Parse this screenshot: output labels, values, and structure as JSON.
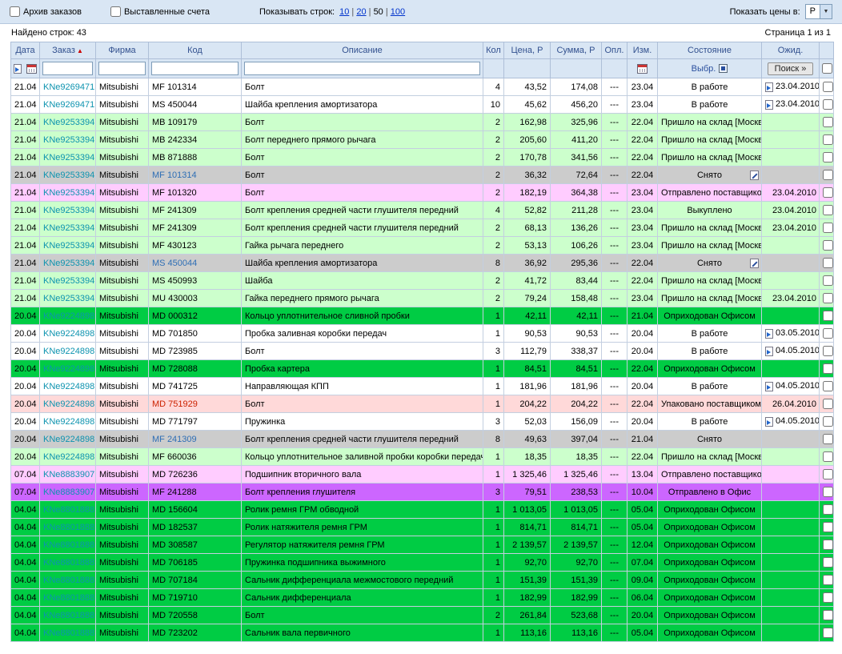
{
  "toolbar": {
    "archive_checkbox_label": "Архив заказов",
    "invoices_checkbox_label": "Выставленные счета",
    "rows_per_page_label": "Показывать строк:",
    "rows_per_page_options": [
      {
        "label": "10",
        "link": true
      },
      {
        "label": "20",
        "link": true
      },
      {
        "label": "50",
        "link": false
      },
      {
        "label": "100",
        "link": true
      }
    ],
    "currency_label": "Показать цены в:",
    "currency_value": "Р"
  },
  "statusbar": {
    "found_text": "Найдено строк: 43",
    "page_text": "Страница 1 из 1"
  },
  "colors": {
    "header_bg": "#d9e6f4",
    "row_white": "#ffffff",
    "row_lightgreen": "#ccffcc",
    "row_green": "#00cc44",
    "row_gray": "#cccccc",
    "row_magenta": "#ffccff",
    "row_salmon": "#ffd9d9",
    "row_purple": "#cc66ff",
    "order_link": "#0d93af",
    "sort_arrow": "#cc0000"
  },
  "table": {
    "headers": {
      "date": "Дата",
      "order": "Заказ",
      "firm": "Фирма",
      "code": "Код",
      "desc": "Описание",
      "qty": "Кол",
      "price": "Цена, Р",
      "sum": "Сумма, Р",
      "paid": "Опл.",
      "mod": "Изм.",
      "state": "Состояние",
      "wait": "Ожид."
    },
    "filter_row": {
      "select_label": "Выбр.",
      "search_button_label": "Поиск »"
    },
    "rows": [
      {
        "date": "21.04",
        "order": "KNe9269471",
        "firm": "Mitsubishi",
        "code": "MF 101314",
        "code_style": "normal",
        "desc": "Болт",
        "qty": "4",
        "price": "43,52",
        "sum": "174,08",
        "paid": "---",
        "mod": "23.04",
        "state": "В работе",
        "edit_icon": false,
        "wait": "23.04.2010",
        "wait_icon": true,
        "bg": "white"
      },
      {
        "date": "21.04",
        "order": "KNe9269471",
        "firm": "Mitsubishi",
        "code": "MS 450044",
        "code_style": "normal",
        "desc": "Шайба крепления амортизатора",
        "qty": "10",
        "price": "45,62",
        "sum": "456,20",
        "paid": "---",
        "mod": "23.04",
        "state": "В работе",
        "edit_icon": false,
        "wait": "23.04.2010",
        "wait_icon": true,
        "bg": "white"
      },
      {
        "date": "21.04",
        "order": "KNe9253394",
        "firm": "Mitsubishi",
        "code": "MB 109179",
        "code_style": "normal",
        "desc": "Болт",
        "qty": "2",
        "price": "162,98",
        "sum": "325,96",
        "paid": "---",
        "mod": "22.04",
        "state": "Пришло на склад [Москва]",
        "edit_icon": false,
        "wait": "",
        "wait_icon": false,
        "bg": "lightgreen"
      },
      {
        "date": "21.04",
        "order": "KNe9253394",
        "firm": "Mitsubishi",
        "code": "MB 242334",
        "code_style": "normal",
        "desc": "Болт переднего прямого рычага",
        "qty": "2",
        "price": "205,60",
        "sum": "411,20",
        "paid": "---",
        "mod": "22.04",
        "state": "Пришло на склад [Москва]",
        "edit_icon": false,
        "wait": "",
        "wait_icon": false,
        "bg": "lightgreen"
      },
      {
        "date": "21.04",
        "order": "KNe9253394",
        "firm": "Mitsubishi",
        "code": "MB 871888",
        "code_style": "normal",
        "desc": "Болт",
        "qty": "2",
        "price": "170,78",
        "sum": "341,56",
        "paid": "---",
        "mod": "22.04",
        "state": "Пришло на склад [Москва]",
        "edit_icon": false,
        "wait": "",
        "wait_icon": false,
        "bg": "lightgreen"
      },
      {
        "date": "21.04",
        "order": "KNe9253394",
        "firm": "Mitsubishi",
        "code": "MF 101314",
        "code_style": "link",
        "desc": "Болт",
        "qty": "2",
        "price": "36,32",
        "sum": "72,64",
        "paid": "---",
        "mod": "22.04",
        "state": "Снято",
        "edit_icon": true,
        "wait": "",
        "wait_icon": false,
        "bg": "gray"
      },
      {
        "date": "21.04",
        "order": "KNe9253394",
        "firm": "Mitsubishi",
        "code": "MF 101320",
        "code_style": "normal",
        "desc": "Болт",
        "qty": "2",
        "price": "182,19",
        "sum": "364,38",
        "paid": "---",
        "mod": "23.04",
        "state": "Отправлено поставщиком",
        "edit_icon": false,
        "wait": "23.04.2010",
        "wait_icon": false,
        "bg": "magenta"
      },
      {
        "date": "21.04",
        "order": "KNe9253394",
        "firm": "Mitsubishi",
        "code": "MF 241309",
        "code_style": "normal",
        "desc": "Болт крепления средней части глушителя передний",
        "qty": "4",
        "price": "52,82",
        "sum": "211,28",
        "paid": "---",
        "mod": "23.04",
        "state": "Выкуплено",
        "edit_icon": false,
        "wait": "23.04.2010",
        "wait_icon": false,
        "bg": "lightgreen"
      },
      {
        "date": "21.04",
        "order": "KNe9253394",
        "firm": "Mitsubishi",
        "code": "MF 241309",
        "code_style": "normal",
        "desc": "Болт крепления средней части глушителя передний",
        "qty": "2",
        "price": "68,13",
        "sum": "136,26",
        "paid": "---",
        "mod": "23.04",
        "state": "Пришло на склад [Москва]",
        "edit_icon": false,
        "wait": "23.04.2010",
        "wait_icon": false,
        "bg": "lightgreen"
      },
      {
        "date": "21.04",
        "order": "KNe9253394",
        "firm": "Mitsubishi",
        "code": "MF 430123",
        "code_style": "normal",
        "desc": "Гайка рычага переднего",
        "qty": "2",
        "price": "53,13",
        "sum": "106,26",
        "paid": "---",
        "mod": "23.04",
        "state": "Пришло на склад [Москва]",
        "edit_icon": false,
        "wait": "",
        "wait_icon": false,
        "bg": "lightgreen"
      },
      {
        "date": "21.04",
        "order": "KNe9253394",
        "firm": "Mitsubishi",
        "code": "MS 450044",
        "code_style": "link",
        "desc": "Шайба крепления амортизатора",
        "qty": "8",
        "price": "36,92",
        "sum": "295,36",
        "paid": "---",
        "mod": "22.04",
        "state": "Снято",
        "edit_icon": true,
        "wait": "",
        "wait_icon": false,
        "bg": "gray"
      },
      {
        "date": "21.04",
        "order": "KNe9253394",
        "firm": "Mitsubishi",
        "code": "MS 450993",
        "code_style": "normal",
        "desc": "Шайба",
        "qty": "2",
        "price": "41,72",
        "sum": "83,44",
        "paid": "---",
        "mod": "22.04",
        "state": "Пришло на склад [Москва]",
        "edit_icon": false,
        "wait": "",
        "wait_icon": false,
        "bg": "lightgreen"
      },
      {
        "date": "21.04",
        "order": "KNe9253394",
        "firm": "Mitsubishi",
        "code": "MU 430003",
        "code_style": "normal",
        "desc": "Гайка переднего прямого рычага",
        "qty": "2",
        "price": "79,24",
        "sum": "158,48",
        "paid": "---",
        "mod": "23.04",
        "state": "Пришло на склад [Москва]",
        "edit_icon": false,
        "wait": "23.04.2010",
        "wait_icon": false,
        "bg": "lightgreen"
      },
      {
        "date": "20.04",
        "order": "KNe9224898",
        "firm": "Mitsubishi",
        "code": "MD 000312",
        "code_style": "normal",
        "desc": "Кольцо уплотнительное сливной пробки",
        "qty": "1",
        "price": "42,11",
        "sum": "42,11",
        "paid": "---",
        "mod": "21.04",
        "state": "Оприходован Офисом",
        "edit_icon": false,
        "wait": "",
        "wait_icon": false,
        "bg": "green"
      },
      {
        "date": "20.04",
        "order": "KNe9224898",
        "firm": "Mitsubishi",
        "code": "MD 701850",
        "code_style": "normal",
        "desc": "Пробка заливная коробки передач",
        "qty": "1",
        "price": "90,53",
        "sum": "90,53",
        "paid": "---",
        "mod": "20.04",
        "state": "В работе",
        "edit_icon": false,
        "wait": "03.05.2010",
        "wait_icon": true,
        "bg": "white"
      },
      {
        "date": "20.04",
        "order": "KNe9224898",
        "firm": "Mitsubishi",
        "code": "MD 723985",
        "code_style": "normal",
        "desc": "Болт",
        "qty": "3",
        "price": "112,79",
        "sum": "338,37",
        "paid": "---",
        "mod": "20.04",
        "state": "В работе",
        "edit_icon": false,
        "wait": "04.05.2010",
        "wait_icon": true,
        "bg": "white"
      },
      {
        "date": "20.04",
        "order": "KNe9224898",
        "firm": "Mitsubishi",
        "code": "MD 728088",
        "code_style": "normal",
        "desc": "Пробка картера",
        "qty": "1",
        "price": "84,51",
        "sum": "84,51",
        "paid": "---",
        "mod": "22.04",
        "state": "Оприходован Офисом",
        "edit_icon": false,
        "wait": "",
        "wait_icon": false,
        "bg": "green"
      },
      {
        "date": "20.04",
        "order": "KNe9224898",
        "firm": "Mitsubishi",
        "code": "MD 741725",
        "code_style": "normal",
        "desc": "Направляющая КПП",
        "qty": "1",
        "price": "181,96",
        "sum": "181,96",
        "paid": "---",
        "mod": "20.04",
        "state": "В работе",
        "edit_icon": false,
        "wait": "04.05.2010",
        "wait_icon": true,
        "bg": "white"
      },
      {
        "date": "20.04",
        "order": "KNe9224898",
        "firm": "Mitsubishi",
        "code": "MD 751929",
        "code_style": "red",
        "desc": "Болт",
        "qty": "1",
        "price": "204,22",
        "sum": "204,22",
        "paid": "---",
        "mod": "22.04",
        "state": "Упаковано поставщиком",
        "edit_icon": false,
        "wait": "26.04.2010",
        "wait_icon": false,
        "bg": "salmon"
      },
      {
        "date": "20.04",
        "order": "KNe9224898",
        "firm": "Mitsubishi",
        "code": "MD 771797",
        "code_style": "normal",
        "desc": "Пружинка",
        "qty": "3",
        "price": "52,03",
        "sum": "156,09",
        "paid": "---",
        "mod": "20.04",
        "state": "В работе",
        "edit_icon": false,
        "wait": "04.05.2010",
        "wait_icon": true,
        "bg": "white"
      },
      {
        "date": "20.04",
        "order": "KNe9224898",
        "firm": "Mitsubishi",
        "code": "MF 241309",
        "code_style": "link",
        "desc": "Болт крепления средней части глушителя передний",
        "qty": "8",
        "price": "49,63",
        "sum": "397,04",
        "paid": "---",
        "mod": "21.04",
        "state": "Снято",
        "edit_icon": false,
        "wait": "",
        "wait_icon": false,
        "bg": "gray"
      },
      {
        "date": "20.04",
        "order": "KNe9224898",
        "firm": "Mitsubishi",
        "code": "MF 660036",
        "code_style": "normal",
        "desc": "Кольцо уплотнительное заливной пробки коробки передач",
        "qty": "1",
        "price": "18,35",
        "sum": "18,35",
        "paid": "---",
        "mod": "22.04",
        "state": "Пришло на склад [Москва]",
        "edit_icon": false,
        "wait": "",
        "wait_icon": false,
        "bg": "lightgreen"
      },
      {
        "date": "07.04",
        "order": "KNe8883907",
        "firm": "Mitsubishi",
        "code": "MD 726236",
        "code_style": "normal",
        "desc": "Подшипник вторичного вала",
        "qty": "1",
        "price": "1 325,46",
        "sum": "1 325,46",
        "paid": "---",
        "mod": "13.04",
        "state": "Отправлено поставщиком",
        "edit_icon": false,
        "wait": "",
        "wait_icon": false,
        "bg": "magenta"
      },
      {
        "date": "07.04",
        "order": "KNe8883907",
        "firm": "Mitsubishi",
        "code": "MF 241288",
        "code_style": "normal",
        "desc": "Болт крепления глушителя",
        "qty": "3",
        "price": "79,51",
        "sum": "238,53",
        "paid": "---",
        "mod": "10.04",
        "state": "Отправлено в Офис",
        "edit_icon": false,
        "wait": "",
        "wait_icon": false,
        "bg": "purple"
      },
      {
        "date": "04.04",
        "order": "KNe8801888",
        "firm": "Mitsubishi",
        "code": "MD 156604",
        "code_style": "normal",
        "desc": "Ролик ремня ГРМ обводной",
        "qty": "1",
        "price": "1 013,05",
        "sum": "1 013,05",
        "paid": "---",
        "mod": "05.04",
        "state": "Оприходован Офисом",
        "edit_icon": false,
        "wait": "",
        "wait_icon": false,
        "bg": "green"
      },
      {
        "date": "04.04",
        "order": "KNe8801888",
        "firm": "Mitsubishi",
        "code": "MD 182537",
        "code_style": "normal",
        "desc": "Ролик натяжителя ремня ГРМ",
        "qty": "1",
        "price": "814,71",
        "sum": "814,71",
        "paid": "---",
        "mod": "05.04",
        "state": "Оприходован Офисом",
        "edit_icon": false,
        "wait": "",
        "wait_icon": false,
        "bg": "green"
      },
      {
        "date": "04.04",
        "order": "KNe8801888",
        "firm": "Mitsubishi",
        "code": "MD 308587",
        "code_style": "normal",
        "desc": "Регулятор натяжителя ремня ГРМ",
        "qty": "1",
        "price": "2 139,57",
        "sum": "2 139,57",
        "paid": "---",
        "mod": "12.04",
        "state": "Оприходован Офисом",
        "edit_icon": false,
        "wait": "",
        "wait_icon": false,
        "bg": "green"
      },
      {
        "date": "04.04",
        "order": "KNe8801888",
        "firm": "Mitsubishi",
        "code": "MD 706185",
        "code_style": "normal",
        "desc": "Пружинка подшипника выжимного",
        "qty": "1",
        "price": "92,70",
        "sum": "92,70",
        "paid": "---",
        "mod": "07.04",
        "state": "Оприходован Офисом",
        "edit_icon": false,
        "wait": "",
        "wait_icon": false,
        "bg": "green"
      },
      {
        "date": "04.04",
        "order": "KNe8801888",
        "firm": "Mitsubishi",
        "code": "MD 707184",
        "code_style": "normal",
        "desc": "Сальник дифференциала межмостового передний",
        "qty": "1",
        "price": "151,39",
        "sum": "151,39",
        "paid": "---",
        "mod": "09.04",
        "state": "Оприходован Офисом",
        "edit_icon": false,
        "wait": "",
        "wait_icon": false,
        "bg": "green"
      },
      {
        "date": "04.04",
        "order": "KNe8801888",
        "firm": "Mitsubishi",
        "code": "MD 719710",
        "code_style": "normal",
        "desc": "Сальник дифференциала",
        "qty": "1",
        "price": "182,99",
        "sum": "182,99",
        "paid": "---",
        "mod": "06.04",
        "state": "Оприходован Офисом",
        "edit_icon": false,
        "wait": "",
        "wait_icon": false,
        "bg": "green"
      },
      {
        "date": "04.04",
        "order": "KNe8801888",
        "firm": "Mitsubishi",
        "code": "MD 720558",
        "code_style": "normal",
        "desc": "Болт",
        "qty": "2",
        "price": "261,84",
        "sum": "523,68",
        "paid": "---",
        "mod": "20.04",
        "state": "Оприходован Офисом",
        "edit_icon": false,
        "wait": "",
        "wait_icon": false,
        "bg": "green"
      },
      {
        "date": "04.04",
        "order": "KNe8801888",
        "firm": "Mitsubishi",
        "code": "MD 723202",
        "code_style": "normal",
        "desc": "Сальник вала первичного",
        "qty": "1",
        "price": "113,16",
        "sum": "113,16",
        "paid": "---",
        "mod": "05.04",
        "state": "Оприходован Офисом",
        "edit_icon": false,
        "wait": "",
        "wait_icon": false,
        "bg": "green"
      }
    ]
  }
}
